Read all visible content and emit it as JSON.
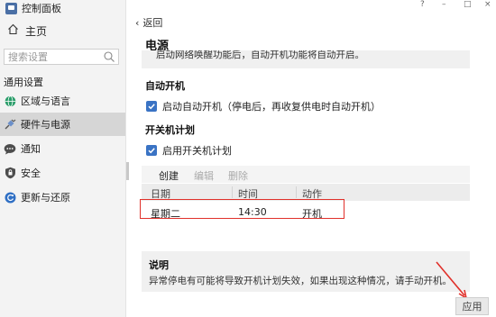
{
  "window": {
    "title": "控制面板",
    "buttons": {
      "help": "?",
      "minimize": "–",
      "maximize": "□",
      "close": "×"
    }
  },
  "sidebar": {
    "home": "主页",
    "search_placeholder": "搜索设置",
    "group_label": "通用设置",
    "items": [
      {
        "label": "区域与语言",
        "icon": "globe-icon",
        "active": false
      },
      {
        "label": "硬件与电源",
        "icon": "plug-icon",
        "active": true
      },
      {
        "label": "通知",
        "icon": "chat-bubble-icon",
        "active": false
      },
      {
        "label": "安全",
        "icon": "shield-icon",
        "active": false
      },
      {
        "label": "更新与还原",
        "icon": "refresh-icon",
        "active": false
      }
    ]
  },
  "main": {
    "back_label": "返回",
    "page_title": "电源",
    "info_text": "启动网络唤醒功能后，自动开机功能将自动开启。",
    "auto_power": {
      "heading": "自动开机",
      "checkbox_label": "启动自动开机（停电后，再收复供电时自动开机）",
      "checked": true
    },
    "schedule": {
      "heading": "开关机计划",
      "checkbox_label": "启用开关机计划",
      "checked": true,
      "toolbar": {
        "create": "创建",
        "edit": "编辑",
        "delete": "删除"
      },
      "columns": [
        "日期",
        "时间",
        "动作"
      ],
      "rows": [
        {
          "date": "星期二",
          "time": "14:30",
          "action": "开机"
        }
      ]
    },
    "note": {
      "title": "说明",
      "text": "异常停电有可能将导致开机计划失效，如果出现这种情况，请手动开机。"
    },
    "apply_label": "应用"
  },
  "colors": {
    "accent": "#3a73c4",
    "highlight": "#e0302a",
    "sidebar_bg": "#f3f3f3",
    "active_bg": "#d6d6d6"
  }
}
